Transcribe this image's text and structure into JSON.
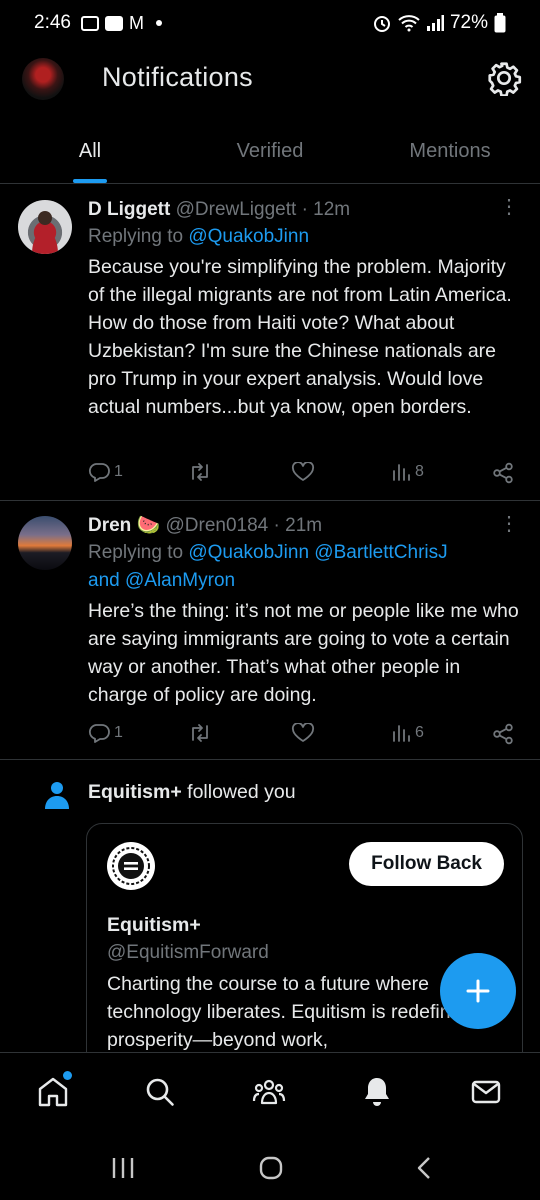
{
  "status_bar": {
    "time": "2:46",
    "battery": "72%"
  },
  "header": {
    "title": "Notifications"
  },
  "tabs": [
    {
      "label": "All",
      "active": true
    },
    {
      "label": "Verified",
      "active": false
    },
    {
      "label": "Mentions",
      "active": false
    }
  ],
  "tweets": [
    {
      "name": "D Liggett",
      "handle": "@DrewLiggett",
      "time": "· 12m",
      "replying_prefix": "Replying to ",
      "replying_to": "@QuakobJinn",
      "text": "Because you're simplifying the problem. Majority of the illegal migrants are not from Latin America. How do those from Haiti vote? What about Uzbekistan? I'm sure the Chinese nationals are pro Trump in your expert analysis. Would love actual numbers...but ya know, open borders.",
      "replies": "1",
      "views": "8"
    },
    {
      "name": "Dren 🍉",
      "handle": "@Dren0184",
      "time": "· 21m",
      "replying_prefix": "Replying to ",
      "replying_to": "@QuakobJinn @BartlettChrisJ",
      "replying_and": "and",
      "replying_to_2": "@AlanMyron",
      "text": "Here’s the thing:  it’s not me or people like me who are saying immigrants are going to vote a certain way or another.  That’s what other people in charge of policy are doing.",
      "replies": "1",
      "views": "6"
    }
  ],
  "follow_notification": {
    "account": "Equitism+",
    "action": "followed you",
    "card": {
      "name": "Equitism+",
      "handle": "@EquitismForward",
      "bio": "Charting the course to a future where technology liberates. Equitism is redefining prosperity—beyond work,",
      "button_label": "Follow Back"
    }
  },
  "icons": {
    "gear": "gear-icon",
    "reply": "reply-icon",
    "retweet": "retweet-icon",
    "like": "heart-icon",
    "views": "views-icon",
    "share": "share-icon"
  },
  "colors": {
    "accent": "#1d9bf0",
    "background": "#000000",
    "muted": "#71767b"
  }
}
